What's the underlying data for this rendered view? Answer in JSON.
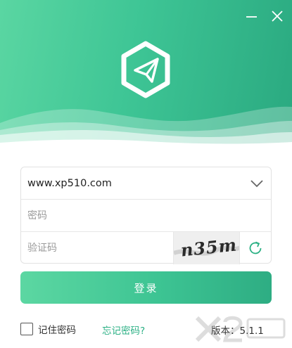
{
  "header": {
    "minimize_icon": "minimize-icon",
    "close_icon": "close-icon",
    "logo_icon": "paper-plane-hexagon-icon"
  },
  "form": {
    "account": {
      "value": "www.xp510.com",
      "placeholder": "",
      "dropdown_icon": "chevron-down-icon"
    },
    "password": {
      "value": "",
      "placeholder": "密码"
    },
    "captcha": {
      "value": "",
      "placeholder": "验证码",
      "image_text": "n35m",
      "refresh_icon": "refresh-icon"
    }
  },
  "login_label": "登录",
  "footer": {
    "remember_label": "记住密码",
    "remember_checked": false,
    "forgot_label": "忘记密码?",
    "version_label": "版本：5.1.1"
  },
  "colors": {
    "brand_green": "#3ec595",
    "link_green": "#2bb084"
  }
}
